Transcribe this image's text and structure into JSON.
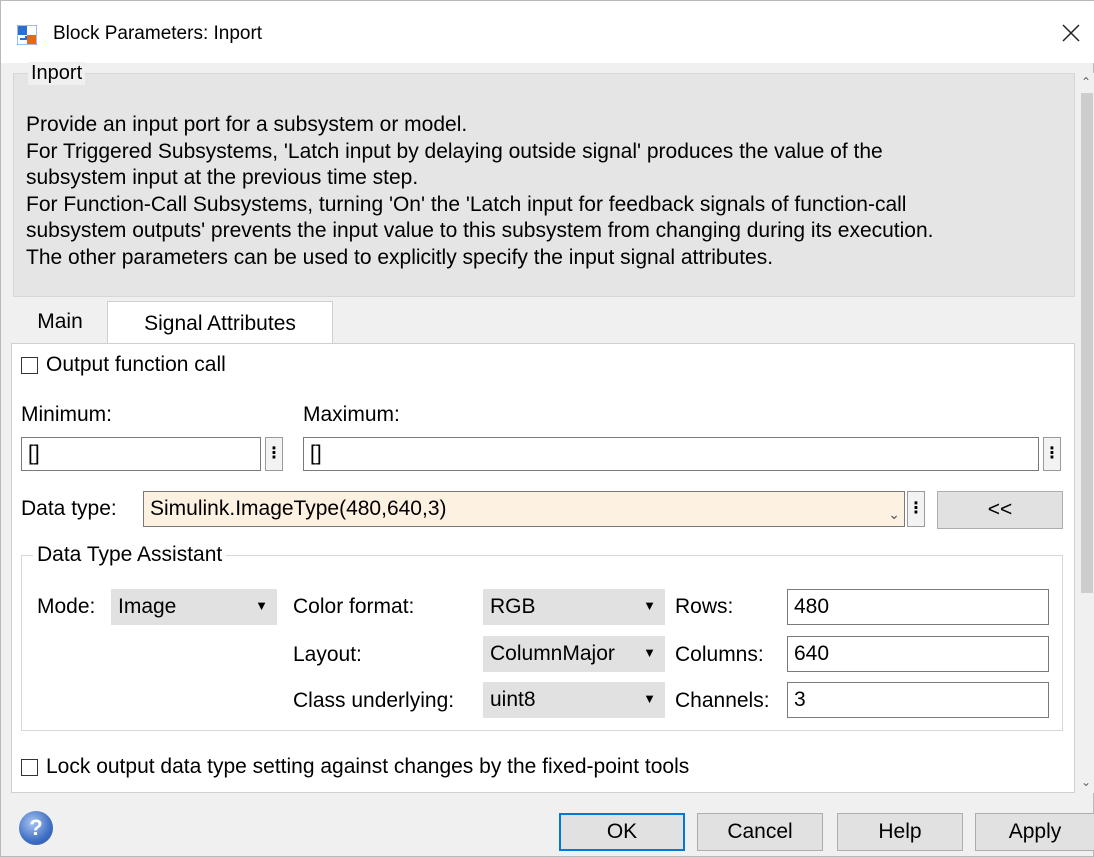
{
  "window": {
    "title": "Block Parameters: Inport"
  },
  "description": {
    "group_title": "Inport",
    "text": "Provide an input port for a subsystem or model.\nFor Triggered Subsystems, 'Latch input by delaying outside signal' produces the value of the\nsubsystem input at the previous time step.\nFor Function-Call Subsystems, turning 'On' the 'Latch input for feedback signals of function-call\nsubsystem outputs' prevents the input value to this subsystem from changing during its execution.\nThe other parameters can be used to explicitly specify the input signal attributes."
  },
  "tabs": [
    {
      "label": "Main",
      "active": false
    },
    {
      "label": "Signal Attributes",
      "active": true
    }
  ],
  "signal_attributes": {
    "output_function_call": {
      "label": "Output function call",
      "checked": false
    },
    "minimum": {
      "label": "Minimum:",
      "value": "[]"
    },
    "maximum": {
      "label": "Maximum:",
      "value": "[]"
    },
    "data_type": {
      "label": "Data type:",
      "value": "Simulink.ImageType(480,640,3)"
    },
    "assistant_toggle_label": "<<",
    "lock_output": {
      "label": "Lock output data type setting against changes by the fixed-point tools",
      "checked": false
    }
  },
  "data_type_assistant": {
    "title": "Data Type Assistant",
    "mode": {
      "label": "Mode:",
      "value": "Image"
    },
    "color_format": {
      "label": "Color format:",
      "value": "RGB"
    },
    "layout": {
      "label": "Layout:",
      "value": "ColumnMajor"
    },
    "class_underlying": {
      "label": "Class underlying:",
      "value": "uint8"
    },
    "rows": {
      "label": "Rows:",
      "value": "480"
    },
    "columns": {
      "label": "Columns:",
      "value": "640"
    },
    "channels": {
      "label": "Channels:",
      "value": "3"
    }
  },
  "buttons": {
    "ok": "OK",
    "cancel": "Cancel",
    "help": "Help",
    "apply": "Apply"
  },
  "icons": {
    "app": "simulink-block-icon",
    "close": "close-icon",
    "help": "help-icon"
  }
}
